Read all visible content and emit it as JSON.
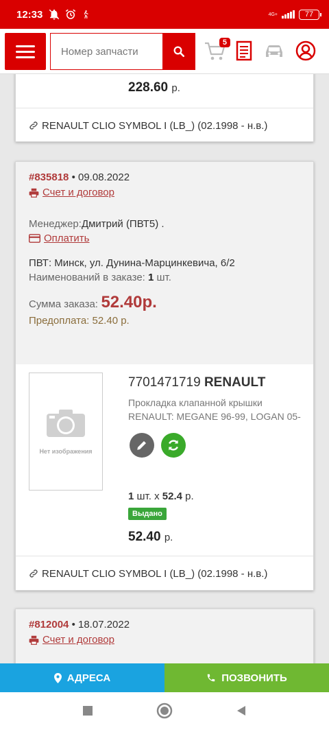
{
  "statusbar": {
    "time": "12:33",
    "network": "4G+",
    "battery": "77"
  },
  "header": {
    "search_placeholder": "Номер запчасти",
    "cart_count": "5"
  },
  "prev_order": {
    "price": "228.60",
    "price_unit": "р.",
    "vehicle": "RENAULT CLIO SYMBOL I (LB_) (02.1998 - н.в.)"
  },
  "order": {
    "number": "#835818",
    "date": "• 09.08.2022",
    "invoice_link": "Счет и договор",
    "manager_label": "Менеджер:",
    "manager_name": "Дмитрий (ПВТ5) .",
    "pay_link": "Оплатить",
    "pickup": "ПВТ: Минск, ул. Дунина-Марцинкевича, 6/2",
    "items_label": "Наименований в заказе:",
    "items_count": "1",
    "items_unit": "шт.",
    "sum_label": "Сумма заказа:",
    "sum_value": "52.40р.",
    "prepay": "Предоплата: 52.40 р.",
    "item": {
      "code": "7701471719",
      "brand": "RENAULT",
      "desc_line1": "Прокладка клапанной крышки",
      "desc_line2": "RENAULT: MEGANE 96-99, LOGAN 05-",
      "no_image": "Нет изображения",
      "qty": "1",
      "qty_text": "шт. x",
      "unit_price": "52.4",
      "unit_price_suffix": "р.",
      "status": "Выдано",
      "total": "52.40",
      "total_unit": "р."
    },
    "vehicle": "RENAULT CLIO SYMBOL I (LB_) (02.1998 - н.в.)"
  },
  "next_order": {
    "number": "#812004",
    "date": "• 18.07.2022",
    "invoice_link": "Счет и договор"
  },
  "actions": {
    "addresses": "АДРЕСА",
    "call": "ПОЗВОНИТЬ"
  },
  "colors": {
    "brand_red": "#d90000",
    "link_red": "#b03a3a",
    "address_blue": "#1aa3e0",
    "call_green": "#6fb832",
    "status_green": "#3aa63a"
  }
}
